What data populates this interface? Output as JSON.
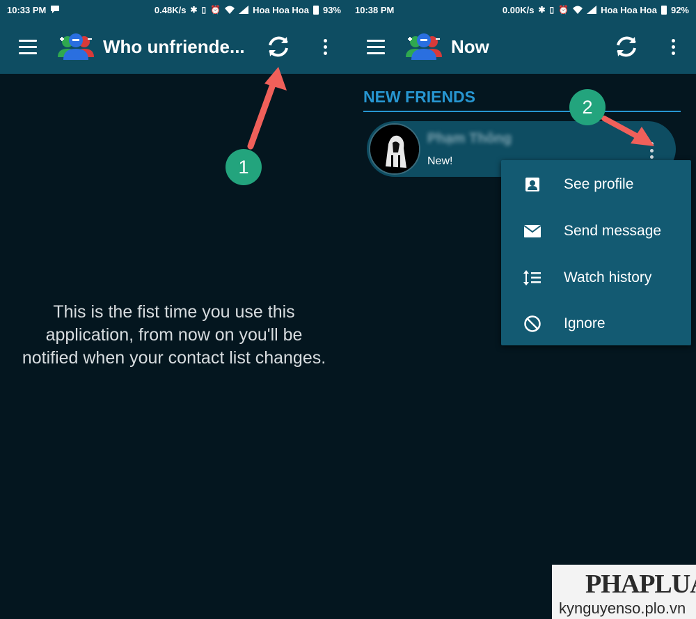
{
  "left_screen": {
    "status_bar": {
      "time": "10:33 PM",
      "network_speed": "0.48K/s",
      "carrier": "Hoa Hoa Hoa",
      "battery": "93%"
    },
    "app_bar": {
      "title": "Who unfriende..."
    },
    "empty_message": "This is the fist time you use this application, from now on you'll be notified when your contact list changes.",
    "annotation": {
      "step": "1"
    }
  },
  "right_screen": {
    "status_bar": {
      "time": "10:38 PM",
      "network_speed": "0.00K/s",
      "carrier": "Hoa Hoa Hoa",
      "battery": "92%"
    },
    "app_bar": {
      "title": "Now"
    },
    "section_title": "NEW FRIENDS",
    "friend": {
      "name": "Phạm Thông",
      "status": "New!"
    },
    "popup_menu": {
      "items": [
        {
          "label": "See profile",
          "icon": "contact-card-icon"
        },
        {
          "label": "Send message",
          "icon": "envelope-icon"
        },
        {
          "label": "Watch history",
          "icon": "history-list-icon"
        },
        {
          "label": "Ignore",
          "icon": "block-icon"
        }
      ]
    },
    "annotation": {
      "step": "2"
    }
  },
  "watermark": {
    "logo": "PHAPLUAT",
    "site": "kynguyenso.plo.vn"
  },
  "colors": {
    "app_bar": "#0e4d62",
    "background": "#04161f",
    "accent": "#2796d1",
    "popup": "#135a72",
    "annotation_badge": "#23a47d",
    "annotation_arrow": "#f0605a"
  }
}
